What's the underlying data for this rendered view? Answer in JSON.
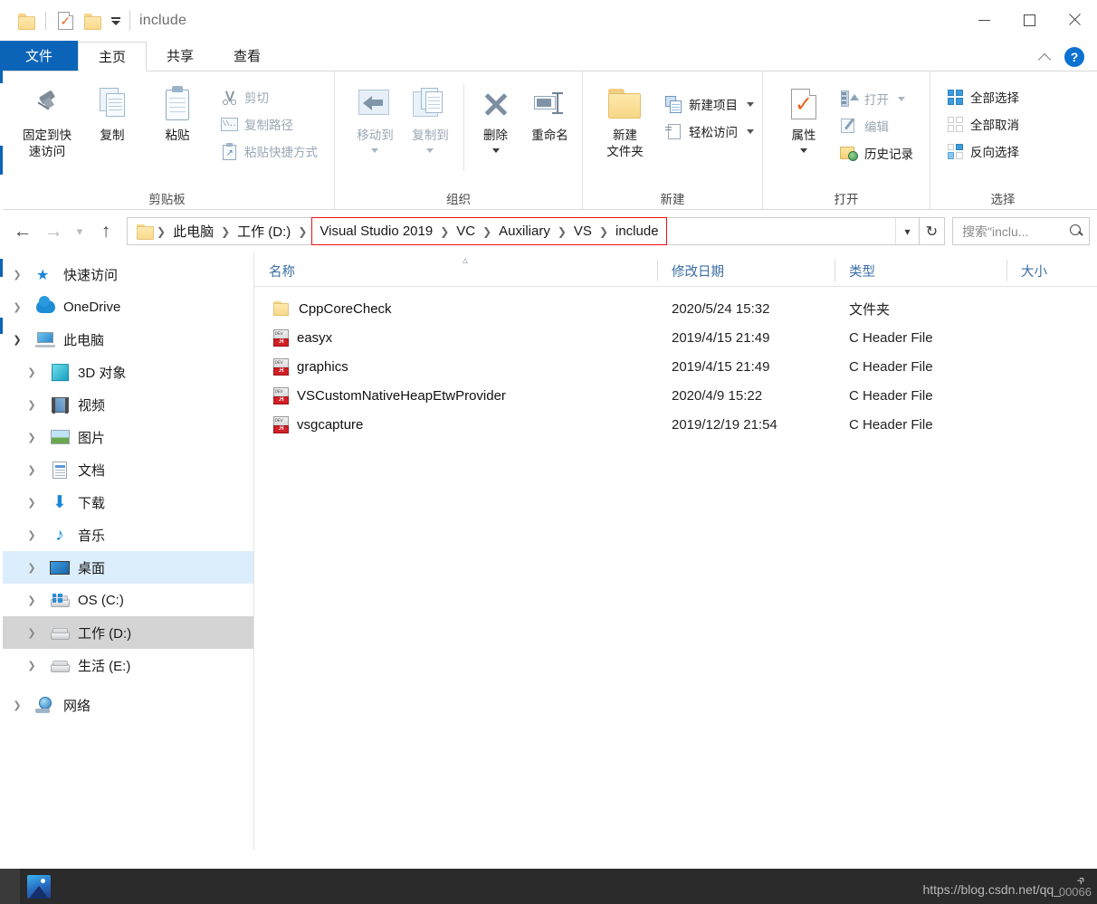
{
  "window": {
    "title": "include",
    "quick_access": {
      "folder_icon": "folder-icon",
      "properties_icon": "properties-icon",
      "new_folder_icon": "new-folder-icon",
      "customize_icon": "customize-quick-access-icon"
    },
    "controls": {
      "minimize": "minimize-icon",
      "maximize": "maximize-icon",
      "close": "close-icon"
    }
  },
  "ribbon": {
    "tabs": [
      {
        "label": "文件",
        "name": "tab-file"
      },
      {
        "label": "主页",
        "name": "tab-home"
      },
      {
        "label": "共享",
        "name": "tab-share"
      },
      {
        "label": "查看",
        "name": "tab-view"
      }
    ],
    "collapse_icon": "chevron-up-icon",
    "help_label": "?",
    "groups": {
      "clipboard": {
        "label": "剪贴板",
        "pin": "固定到快\n速访问",
        "pin_line1": "固定到快",
        "pin_line2": "速访问",
        "copy": "复制",
        "paste": "粘贴",
        "cut": "剪切",
        "copy_path": "复制路径",
        "paste_shortcut": "粘贴快捷方式"
      },
      "organize": {
        "label": "组织",
        "move_to": "移动到",
        "copy_to": "复制到",
        "delete": "删除",
        "rename": "重命名"
      },
      "new": {
        "label": "新建",
        "new_folder_line1": "新建",
        "new_folder_line2": "文件夹",
        "new_item": "新建项目",
        "easy_access": "轻松访问"
      },
      "open": {
        "label": "打开",
        "properties": "属性",
        "open": "打开",
        "edit": "编辑",
        "history": "历史记录"
      },
      "select": {
        "label": "选择",
        "select_all": "全部选择",
        "select_none": "全部取消",
        "invert_selection": "反向选择"
      }
    }
  },
  "addressbar": {
    "back_icon": "back-arrow-icon",
    "forward_icon": "forward-arrow-icon",
    "recent_icon": "recent-locations-icon",
    "up_icon": "up-arrow-icon",
    "breadcrumb_plain": [
      "此电脑",
      "工作 (D:)"
    ],
    "breadcrumb_highlighted": [
      "Visual Studio 2019",
      "VC",
      "Auxiliary",
      "VS",
      "include"
    ],
    "highlight_color": "#ee1111",
    "dropdown_icon": "chevron-down-icon",
    "refresh_icon": "refresh-icon",
    "search_placeholder": "搜索\"inclu...",
    "search_icon": "search-icon"
  },
  "navpane": {
    "items": [
      {
        "label": "快速访问",
        "icon": "star-icon",
        "level": 1,
        "expanded": false,
        "state": "none"
      },
      {
        "label": "OneDrive",
        "icon": "cloud-icon",
        "level": 1,
        "expanded": false,
        "state": "none"
      },
      {
        "label": "此电脑",
        "icon": "this-pc-icon",
        "level": 1,
        "expanded": true,
        "state": "none"
      },
      {
        "label": "3D 对象",
        "icon": "3d-objects-icon",
        "level": 2,
        "expanded": false,
        "state": "none"
      },
      {
        "label": "视频",
        "icon": "videos-icon",
        "level": 2,
        "expanded": false,
        "state": "none"
      },
      {
        "label": "图片",
        "icon": "pictures-icon",
        "level": 2,
        "expanded": false,
        "state": "none"
      },
      {
        "label": "文档",
        "icon": "documents-icon",
        "level": 2,
        "expanded": false,
        "state": "none"
      },
      {
        "label": "下载",
        "icon": "downloads-icon",
        "level": 2,
        "expanded": false,
        "state": "none"
      },
      {
        "label": "音乐",
        "icon": "music-icon",
        "level": 2,
        "expanded": false,
        "state": "none"
      },
      {
        "label": "桌面",
        "icon": "desktop-icon",
        "level": 2,
        "expanded": false,
        "state": "hover"
      },
      {
        "label": "OS (C:)",
        "icon": "windows-drive-icon",
        "level": 2,
        "expanded": false,
        "state": "none"
      },
      {
        "label": "工作 (D:)",
        "icon": "drive-icon",
        "level": 2,
        "expanded": false,
        "state": "selected"
      },
      {
        "label": "生活 (E:)",
        "icon": "drive-icon",
        "level": 2,
        "expanded": false,
        "state": "none"
      },
      {
        "label": "网络",
        "icon": "network-icon",
        "level": 1,
        "expanded": false,
        "state": "none"
      }
    ]
  },
  "filelist": {
    "columns": [
      {
        "label": "名称",
        "name": "column-name"
      },
      {
        "label": "修改日期",
        "name": "column-date-modified"
      },
      {
        "label": "类型",
        "name": "column-type"
      },
      {
        "label": "大小",
        "name": "column-size"
      }
    ],
    "sort_indicator": "ascending",
    "rows": [
      {
        "name": "CppCoreCheck",
        "date": "2020/5/24 15:32",
        "type": "文件夹",
        "size": "",
        "icon": "folder-icon"
      },
      {
        "name": "easyx",
        "date": "2019/4/15 21:49",
        "type": "C Header File",
        "size": "",
        "icon": "c-header-file-icon"
      },
      {
        "name": "graphics",
        "date": "2019/4/15 21:49",
        "type": "C Header File",
        "size": "",
        "icon": "c-header-file-icon"
      },
      {
        "name": "VSCustomNativeHeapEtwProvider",
        "date": "2020/4/9 15:22",
        "type": "C Header File",
        "size": "",
        "icon": "c-header-file-icon"
      },
      {
        "name": "vsgcapture",
        "date": "2019/12/19 21:54",
        "type": "C Header File",
        "size": "",
        "icon": "c-header-file-icon"
      }
    ],
    "scroll_left_icon": "scroll-left-icon",
    "scroll_right_icon": "scroll-right-icon"
  },
  "taskbar": {
    "photos_icon": "photos-app-icon",
    "watermark": "https://blog.csdn.net/qq_",
    "watermark_tail": "00066"
  }
}
